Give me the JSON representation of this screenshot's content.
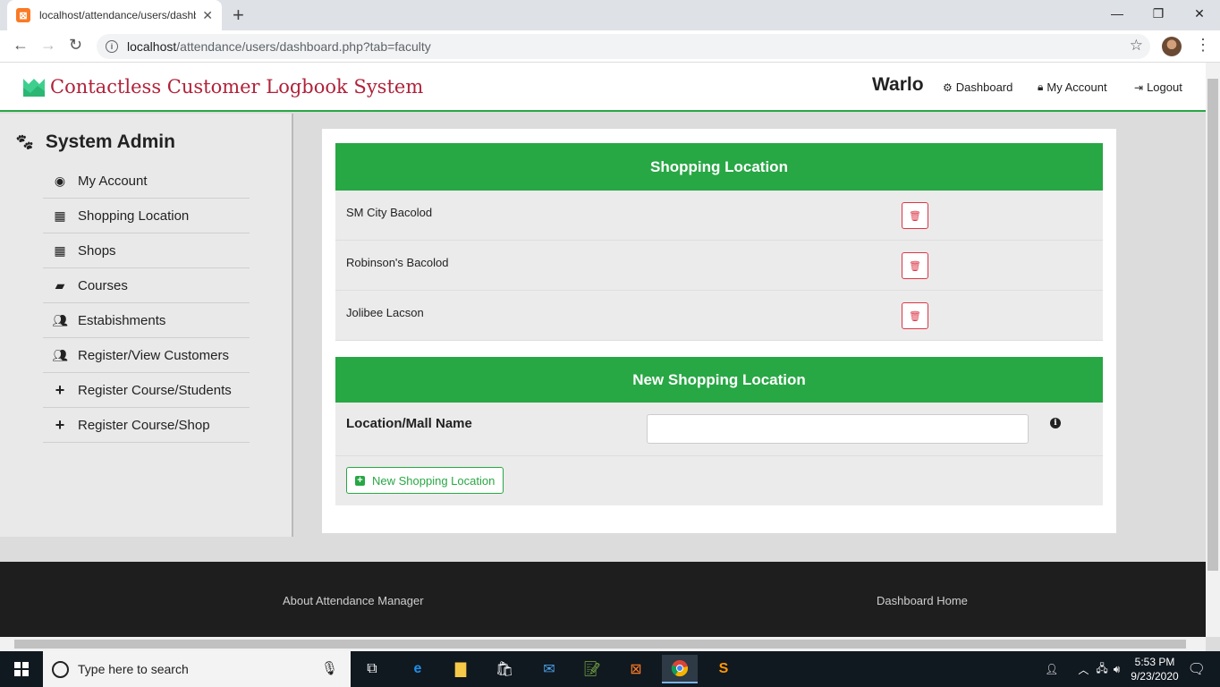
{
  "browser": {
    "tab_title": "localhost/attendance/users/dashb",
    "url_host": "localhost",
    "url_path": "/attendance/users/dashboard.php?tab=faculty"
  },
  "header": {
    "brand": "Contactless Customer Logbook System",
    "user": "Warlo",
    "nav": [
      {
        "icon": "gear-icon",
        "label": "Dashboard"
      },
      {
        "icon": "lock-icon",
        "label": "My Account"
      },
      {
        "icon": "logout-icon",
        "label": "Logout"
      }
    ]
  },
  "sidebar": {
    "title": "System Admin",
    "items": [
      {
        "icon": "user-circle-icon",
        "label": "My Account"
      },
      {
        "icon": "building-icon",
        "label": "Shopping Location"
      },
      {
        "icon": "building-icon",
        "label": "Shops"
      },
      {
        "icon": "book-icon",
        "label": "Courses"
      },
      {
        "icon": "users-icon",
        "label": "Estabishments"
      },
      {
        "icon": "users-icon",
        "label": "Register/View Customers"
      },
      {
        "icon": "plus-icon",
        "label": "Register Course/Students"
      },
      {
        "icon": "plus-icon",
        "label": "Register Course/Shop"
      }
    ]
  },
  "locations": {
    "heading": "Shopping Location",
    "rows": [
      "SM City Bacolod",
      "Robinson's Bacolod",
      "Jolibee Lacson"
    ]
  },
  "new_location": {
    "heading": "New Shopping Location",
    "field_label": "Location/Mall Name",
    "field_value": "",
    "button_label": "New Shopping Location"
  },
  "footer": {
    "about": "About Attendance Manager",
    "home": "Dashboard Home"
  },
  "taskbar": {
    "search_placeholder": "Type here to search",
    "time": "5:53 PM",
    "date": "9/23/2020"
  },
  "colors": {
    "accent_green": "#28a745",
    "brand_red": "#b0223a",
    "danger": "#dc3545"
  }
}
